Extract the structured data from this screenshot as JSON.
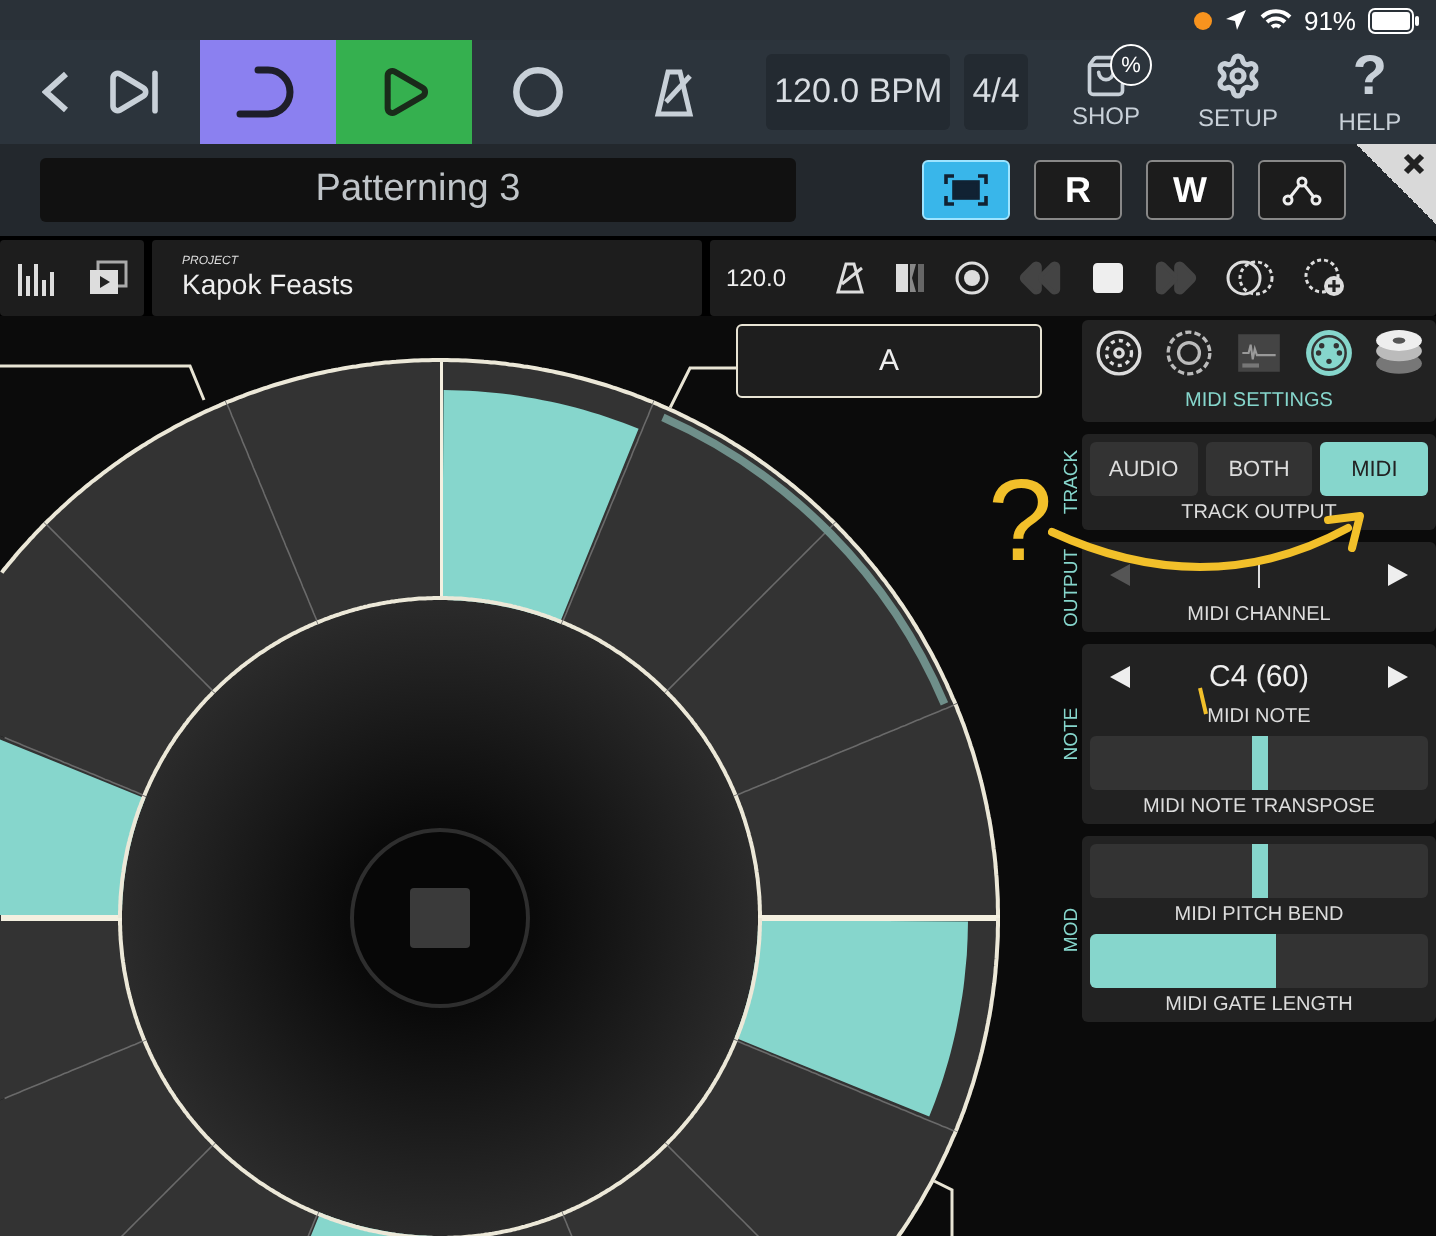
{
  "status_bar": {
    "battery": "91%"
  },
  "transport": {
    "loop_on": true,
    "playing": true,
    "tempo": "120.0 BPM",
    "time_signature": "4/4"
  },
  "toolbar_buttons": [
    {
      "kind": "shop",
      "label": "SHOP",
      "badge": "%"
    },
    {
      "kind": "setup",
      "label": "SETUP"
    },
    {
      "kind": "help",
      "label": "HELP",
      "glyph": "?"
    }
  ],
  "plugin_bar": {
    "title": "Patterning 3",
    "buttons": [
      {
        "kind": "fullscreen",
        "selected": true
      },
      {
        "kind": "text",
        "label": "R",
        "selected": false
      },
      {
        "kind": "text",
        "label": "W",
        "selected": false
      },
      {
        "kind": "nodes",
        "selected": false
      }
    ]
  },
  "host_bar": {
    "project_caption": "PROJECT",
    "project_name": "Kapok Feasts",
    "tempo": "120.0"
  },
  "sequencer": {
    "pattern_label": "A",
    "steps": [
      {
        "on": true
      },
      {
        "on": false
      },
      {
        "on": false
      },
      {
        "on": false
      },
      {
        "on": true
      },
      {
        "on": false
      },
      {
        "on": false
      },
      {
        "on": false
      },
      {
        "on": true
      },
      {
        "on": false
      },
      {
        "on": false
      },
      {
        "on": false
      },
      {
        "on": true
      },
      {
        "on": false
      },
      {
        "on": false
      },
      {
        "on": false
      }
    ]
  },
  "panel": {
    "tabs": [
      {
        "kind": "drum",
        "selected": false
      },
      {
        "kind": "ring",
        "selected": false
      },
      {
        "kind": "sample",
        "selected": false
      },
      {
        "kind": "midi",
        "selected": true
      },
      {
        "kind": "stack",
        "selected": false
      }
    ],
    "tab_title": "MIDI SETTINGS",
    "sections": [
      {
        "label": "TRACK",
        "controls": [
          {
            "kind": "segmented",
            "caption": "TRACK OUTPUT",
            "options": [
              {
                "label": "AUDIO",
                "selected": false
              },
              {
                "label": "BOTH",
                "selected": false
              },
              {
                "label": "MIDI",
                "selected": true
              }
            ]
          }
        ]
      },
      {
        "label": "OUTPUT",
        "controls": [
          {
            "kind": "stepper",
            "caption": "MIDI CHANNEL",
            "prev_disabled": true
          }
        ]
      },
      {
        "label": "NOTE",
        "controls": [
          {
            "kind": "stepper",
            "caption": "MIDI NOTE",
            "value": "C4 (60)",
            "prev_disabled": false
          },
          {
            "kind": "bipolar",
            "caption": "MIDI NOTE TRANSPOSE",
            "level": 0.5
          }
        ]
      },
      {
        "label": "MOD",
        "controls": [
          {
            "kind": "bipolar",
            "caption": "MIDI PITCH BEND",
            "level": 0.5
          },
          {
            "kind": "fill",
            "caption": "MIDI GATE LENGTH",
            "level": 0.55
          }
        ]
      }
    ]
  },
  "annotation": {
    "text": "?"
  }
}
